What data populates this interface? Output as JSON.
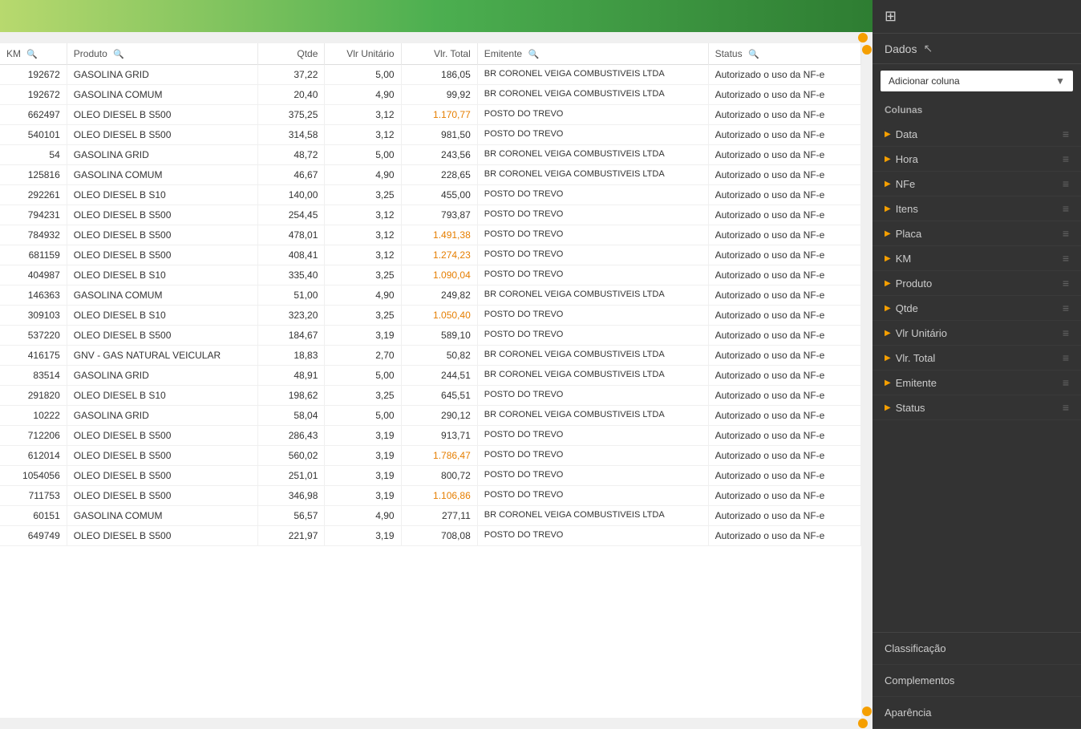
{
  "topBar": {
    "gradient": "green"
  },
  "sidebar": {
    "icon": "⊞",
    "dados_label": "Dados",
    "add_column_label": "Adicionar coluna",
    "colunas_label": "Colunas",
    "columns": [
      {
        "name": "Data",
        "id": "col-data"
      },
      {
        "name": "Hora",
        "id": "col-hora"
      },
      {
        "name": "NFe",
        "id": "col-nfe"
      },
      {
        "name": "Itens",
        "id": "col-itens"
      },
      {
        "name": "Placa",
        "id": "col-placa"
      },
      {
        "name": "KM",
        "id": "col-km"
      },
      {
        "name": "Produto",
        "id": "col-produto"
      },
      {
        "name": "Qtde",
        "id": "col-qtde"
      },
      {
        "name": "Vlr Unitário",
        "id": "col-vlr-unitario"
      },
      {
        "name": "Vlr. Total",
        "id": "col-vlr-total"
      },
      {
        "name": "Emitente",
        "id": "col-emitente"
      },
      {
        "name": "Status",
        "id": "col-status"
      }
    ],
    "bottom_items": [
      "Classificação",
      "Complementos",
      "Aparência"
    ]
  },
  "table": {
    "headers": [
      {
        "label": "KM",
        "searchable": true
      },
      {
        "label": "Produto",
        "searchable": true
      },
      {
        "label": "Qtde",
        "searchable": false
      },
      {
        "label": "Vlr Unitário",
        "searchable": false
      },
      {
        "label": "Vlr. Total",
        "searchable": false
      },
      {
        "label": "Emitente",
        "searchable": true
      },
      {
        "label": "Status",
        "searchable": true
      }
    ],
    "rows": [
      {
        "km": "192672",
        "produto": "GASOLINA GRID",
        "qtde": "37,22",
        "vlr_unit": "5,00",
        "vlr_total": "186,05",
        "emitente": "BR CORONEL VEIGA COMBUSTIVEIS LTDA",
        "status": "Autorizado o uso da NF-e",
        "highlight_total": false
      },
      {
        "km": "192672",
        "produto": "GASOLINA COMUM",
        "qtde": "20,40",
        "vlr_unit": "4,90",
        "vlr_total": "99,92",
        "emitente": "BR CORONEL VEIGA COMBUSTIVEIS LTDA",
        "status": "Autorizado o uso da NF-e",
        "highlight_total": false
      },
      {
        "km": "662497",
        "produto": "OLEO DIESEL B S500",
        "qtde": "375,25",
        "vlr_unit": "3,12",
        "vlr_total": "1.170,77",
        "emitente": "POSTO DO TREVO",
        "status": "Autorizado o uso da NF-e",
        "highlight_total": true
      },
      {
        "km": "540101",
        "produto": "OLEO DIESEL B S500",
        "qtde": "314,58",
        "vlr_unit": "3,12",
        "vlr_total": "981,50",
        "emitente": "POSTO DO TREVO",
        "status": "Autorizado o uso da NF-e",
        "highlight_total": false
      },
      {
        "km": "54",
        "produto": "GASOLINA GRID",
        "qtde": "48,72",
        "vlr_unit": "5,00",
        "vlr_total": "243,56",
        "emitente": "BR CORONEL VEIGA COMBUSTIVEIS LTDA",
        "status": "Autorizado o uso da NF-e",
        "highlight_total": false
      },
      {
        "km": "125816",
        "produto": "GASOLINA COMUM",
        "qtde": "46,67",
        "vlr_unit": "4,90",
        "vlr_total": "228,65",
        "emitente": "BR CORONEL VEIGA COMBUSTIVEIS LTDA",
        "status": "Autorizado o uso da NF-e",
        "highlight_total": false
      },
      {
        "km": "292261",
        "produto": "OLEO DIESEL B S10",
        "qtde": "140,00",
        "vlr_unit": "3,25",
        "vlr_total": "455,00",
        "emitente": "POSTO DO TREVO",
        "status": "Autorizado o uso da NF-e",
        "highlight_total": false
      },
      {
        "km": "794231",
        "produto": "OLEO DIESEL B S500",
        "qtde": "254,45",
        "vlr_unit": "3,12",
        "vlr_total": "793,87",
        "emitente": "POSTO DO TREVO",
        "status": "Autorizado o uso da NF-e",
        "highlight_total": false
      },
      {
        "km": "784932",
        "produto": "OLEO DIESEL B S500",
        "qtde": "478,01",
        "vlr_unit": "3,12",
        "vlr_total": "1.491,38",
        "emitente": "POSTO DO TREVO",
        "status": "Autorizado o uso da NF-e",
        "highlight_total": true
      },
      {
        "km": "681159",
        "produto": "OLEO DIESEL B S500",
        "qtde": "408,41",
        "vlr_unit": "3,12",
        "vlr_total": "1.274,23",
        "emitente": "POSTO DO TREVO",
        "status": "Autorizado o uso da NF-e",
        "highlight_total": true
      },
      {
        "km": "404987",
        "produto": "OLEO DIESEL B S10",
        "qtde": "335,40",
        "vlr_unit": "3,25",
        "vlr_total": "1.090,04",
        "emitente": "POSTO DO TREVO",
        "status": "Autorizado o uso da NF-e",
        "highlight_total": true
      },
      {
        "km": "146363",
        "produto": "GASOLINA COMUM",
        "qtde": "51,00",
        "vlr_unit": "4,90",
        "vlr_total": "249,82",
        "emitente": "BR CORONEL VEIGA COMBUSTIVEIS LTDA",
        "status": "Autorizado o uso da NF-e",
        "highlight_total": false
      },
      {
        "km": "309103",
        "produto": "OLEO DIESEL B S10",
        "qtde": "323,20",
        "vlr_unit": "3,25",
        "vlr_total": "1.050,40",
        "emitente": "POSTO DO TREVO",
        "status": "Autorizado o uso da NF-e",
        "highlight_total": true
      },
      {
        "km": "537220",
        "produto": "OLEO DIESEL B S500",
        "qtde": "184,67",
        "vlr_unit": "3,19",
        "vlr_total": "589,10",
        "emitente": "POSTO DO TREVO",
        "status": "Autorizado o uso da NF-e",
        "highlight_total": false
      },
      {
        "km": "416175",
        "produto": "GNV - GAS NATURAL VEICULAR",
        "qtde": "18,83",
        "vlr_unit": "2,70",
        "vlr_total": "50,82",
        "emitente": "BR CORONEL VEIGA COMBUSTIVEIS LTDA",
        "status": "Autorizado o uso da NF-e",
        "highlight_total": false
      },
      {
        "km": "83514",
        "produto": "GASOLINA GRID",
        "qtde": "48,91",
        "vlr_unit": "5,00",
        "vlr_total": "244,51",
        "emitente": "BR CORONEL VEIGA COMBUSTIVEIS LTDA",
        "status": "Autorizado o uso da NF-e",
        "highlight_total": false
      },
      {
        "km": "291820",
        "produto": "OLEO DIESEL B S10",
        "qtde": "198,62",
        "vlr_unit": "3,25",
        "vlr_total": "645,51",
        "emitente": "POSTO DO TREVO",
        "status": "Autorizado o uso da NF-e",
        "highlight_total": false
      },
      {
        "km": "10222",
        "produto": "GASOLINA GRID",
        "qtde": "58,04",
        "vlr_unit": "5,00",
        "vlr_total": "290,12",
        "emitente": "BR CORONEL VEIGA COMBUSTIVEIS LTDA",
        "status": "Autorizado o uso da NF-e",
        "highlight_total": false
      },
      {
        "km": "712206",
        "produto": "OLEO DIESEL B S500",
        "qtde": "286,43",
        "vlr_unit": "3,19",
        "vlr_total": "913,71",
        "emitente": "POSTO DO TREVO",
        "status": "Autorizado o uso da NF-e",
        "highlight_total": false
      },
      {
        "km": "612014",
        "produto": "OLEO DIESEL B S500",
        "qtde": "560,02",
        "vlr_unit": "3,19",
        "vlr_total": "1.786,47",
        "emitente": "POSTO DO TREVO",
        "status": "Autorizado o uso da NF-e",
        "highlight_total": true
      },
      {
        "km": "1054056",
        "produto": "OLEO DIESEL B S500",
        "qtde": "251,01",
        "vlr_unit": "3,19",
        "vlr_total": "800,72",
        "emitente": "POSTO DO TREVO",
        "status": "Autorizado o uso da NF-e",
        "highlight_total": false
      },
      {
        "km": "711753",
        "produto": "OLEO DIESEL B S500",
        "qtde": "346,98",
        "vlr_unit": "3,19",
        "vlr_total": "1.106,86",
        "emitente": "POSTO DO TREVO",
        "status": "Autorizado o uso da NF-e",
        "highlight_total": true
      },
      {
        "km": "60151",
        "produto": "GASOLINA COMUM",
        "qtde": "56,57",
        "vlr_unit": "4,90",
        "vlr_total": "277,11",
        "emitente": "BR CORONEL VEIGA COMBUSTIVEIS LTDA",
        "status": "Autorizado o uso da NF-e",
        "highlight_total": false
      },
      {
        "km": "649749",
        "produto": "OLEO DIESEL B S500",
        "qtde": "221,97",
        "vlr_unit": "3,19",
        "vlr_total": "708,08",
        "emitente": "POSTO DO TREVO",
        "status": "Autorizado o uso da NF-e",
        "highlight_total": false
      }
    ]
  }
}
